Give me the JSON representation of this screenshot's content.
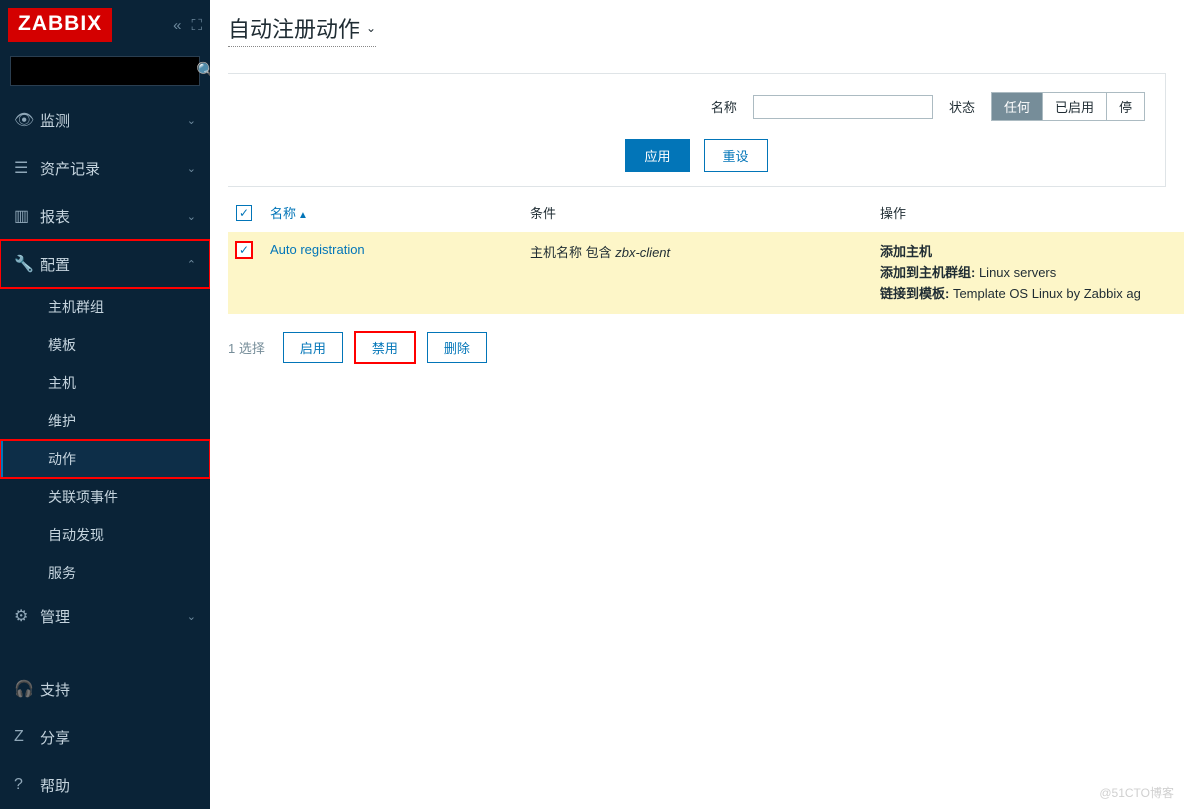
{
  "brand": "ZABBIX",
  "search": {
    "placeholder": ""
  },
  "nav": {
    "monitoring": "监测",
    "inventory": "资产记录",
    "reports": "报表",
    "configuration": "配置",
    "administration": "管理",
    "support": "支持",
    "share": "分享",
    "help": "帮助"
  },
  "config_sub": {
    "hostgroups": "主机群组",
    "templates": "模板",
    "hosts": "主机",
    "maintenance": "维护",
    "actions": "动作",
    "correlation": "关联项事件",
    "discovery": "自动发现",
    "services": "服务"
  },
  "page": {
    "title": "自动注册动作"
  },
  "filter": {
    "name_label": "名称",
    "name_value": "",
    "status_label": "状态",
    "status_any": "任何",
    "status_enabled": "已启用",
    "status_disabled": "停",
    "apply": "应用",
    "reset": "重设"
  },
  "table": {
    "col_name": "名称",
    "col_condition": "条件",
    "col_operation": "操作",
    "rows": [
      {
        "name": "Auto registration",
        "condition_prefix": "主机名称 包含 ",
        "condition_value": "zbx-client",
        "ops": [
          {
            "label": "添加主机",
            "value": ""
          },
          {
            "label": "添加到主机群组:",
            "value": " Linux servers"
          },
          {
            "label": "链接到模板:",
            "value": " Template OS Linux by Zabbix ag"
          }
        ]
      }
    ]
  },
  "bulk": {
    "selected_text": "1 选择",
    "enable": "启用",
    "disable": "禁用",
    "delete": "删除"
  },
  "watermark": "@51CTO博客"
}
